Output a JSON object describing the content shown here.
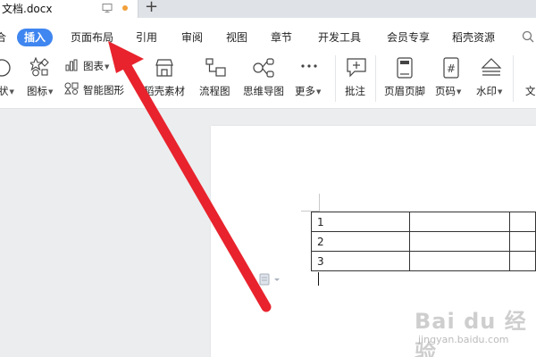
{
  "titlebar": {
    "doc_title": "文档.docx",
    "new_tab_symbol": "+"
  },
  "menu": {
    "tabs": [
      {
        "label": "插入",
        "active": true
      },
      {
        "label": "页面布局"
      },
      {
        "label": "引用"
      },
      {
        "label": "审阅"
      },
      {
        "label": "视图"
      },
      {
        "label": "章节"
      },
      {
        "label": "开发工具"
      },
      {
        "label": "会员专享"
      },
      {
        "label": "稻壳资源"
      }
    ],
    "partial_left": "合"
  },
  "toolbar": {
    "shape_label": "状",
    "icons_label": "图标",
    "chart_label": "图表",
    "smart_graphic_label": "智能图形",
    "docer_material_label": "稻壳素材",
    "flowchart_label": "流程图",
    "mindmap_label": "思维导图",
    "more_label": "更多",
    "comment_label": "批注",
    "header_footer_label": "页眉页脚",
    "page_number_label": "页码",
    "watermark_label": "水印",
    "partial_right_label": "文"
  },
  "document": {
    "table_rows": [
      [
        "1",
        "",
        ""
      ],
      [
        "2",
        "",
        ""
      ],
      [
        "3",
        "",
        ""
      ]
    ]
  },
  "watermark": {
    "main": "Bai du 经验",
    "sub": "jingyan.baidu.com"
  },
  "colors": {
    "accent": "#3f86f0",
    "arrow": "#e8232d"
  }
}
